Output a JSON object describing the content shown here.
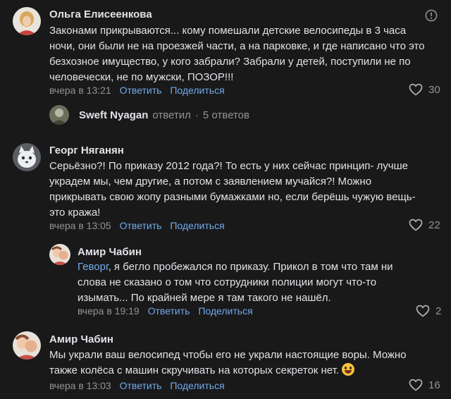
{
  "comments": [
    {
      "author": "Ольга Елисеенкова",
      "lines": [
        "Законами прикрываются... кому помешали детские велосипеды в 3 часа",
        "ночи, они были не на проезжей части, а на парковке, и где написано что это",
        "безхозное имущество, у кого забрали? Забрали у детей, поступили не по",
        "человечески, не по мужски, ПОЗОР!!!"
      ],
      "time": "вчера в 13:21",
      "reply_label": "Ответить",
      "share_label": "Поделиться",
      "likes": "30"
    },
    {
      "author": "Георг Няганян",
      "lines": [
        "Серьёзно?! По приказу 2012 года?! То есть у них сейчас принцип- лучше",
        "украдем мы, чем другие, а потом с заявлением мучайся?! Можно",
        "прикрывать свою жопу разными бумажками но, если берёшь чужую вещь-",
        "это кража!"
      ],
      "time": "вчера в 13:05",
      "reply_label": "Ответить",
      "share_label": "Поделиться",
      "likes": "22"
    },
    {
      "author": "Амир Чабин",
      "mention": "Геворг",
      "lines": [
        ", я бегло пробежался по приказу. Прикол в том что там ни",
        "слова не сказано о том что сотрудники полиции могут что-то",
        "изымать... По крайней мере я там такого не нашёл."
      ],
      "time": "вчера в 19:19",
      "reply_label": "Ответить",
      "share_label": "Поделиться",
      "likes": "2"
    },
    {
      "author": "Амир Чабин",
      "lines": [
        "Мы украли ваш велосипед чтобы его не украли настоящие воры. Можно",
        "также колёса с машин скручивать на которых секреток нет."
      ],
      "time": "вчера в 13:03",
      "reply_label": "Ответить",
      "share_label": "Поделиться",
      "likes": "16"
    }
  ],
  "thread": {
    "author": "Sweft Nyagan",
    "verb": "ответил",
    "dot": "·",
    "count": "5 ответов"
  },
  "colors": {
    "background": "#19191a",
    "text": "#e1e3e6",
    "secondary": "#939393",
    "link": "#71aaeb"
  }
}
